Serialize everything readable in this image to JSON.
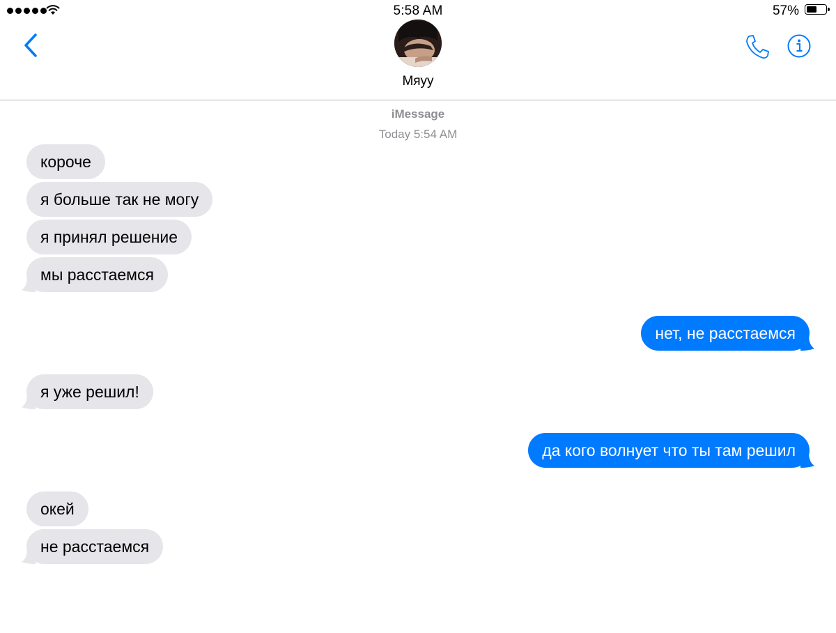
{
  "status_bar": {
    "time": "5:58 AM",
    "battery_percent": "57%",
    "battery_level": 0.57,
    "signal_bars": 5,
    "icons": [
      "signal-dots-icon",
      "wifi-icon",
      "battery-icon"
    ]
  },
  "header": {
    "contact_name": "Мяуу",
    "icons": [
      "chevron-left-icon",
      "phone-icon",
      "info-icon"
    ]
  },
  "conversation": {
    "service": "iMessage",
    "timestamp": "Today 5:54 AM",
    "messages": [
      {
        "text": "короче",
        "direction": "incoming"
      },
      {
        "text": "я больше так не могу",
        "direction": "incoming"
      },
      {
        "text": "я принял решение",
        "direction": "incoming"
      },
      {
        "text": "мы расстаемся",
        "direction": "incoming"
      },
      {
        "text": "нет, не расстаемся",
        "direction": "outgoing"
      },
      {
        "text": "я уже решил!",
        "direction": "incoming"
      },
      {
        "text": "да кого волнует что ты там решил",
        "direction": "outgoing"
      },
      {
        "text": "окей",
        "direction": "incoming"
      },
      {
        "text": "не расстаемся",
        "direction": "incoming"
      }
    ]
  },
  "colors": {
    "accent": "#007aff",
    "incoming_bubble": "#e5e5ea",
    "secondary_text": "#8e8e93"
  }
}
